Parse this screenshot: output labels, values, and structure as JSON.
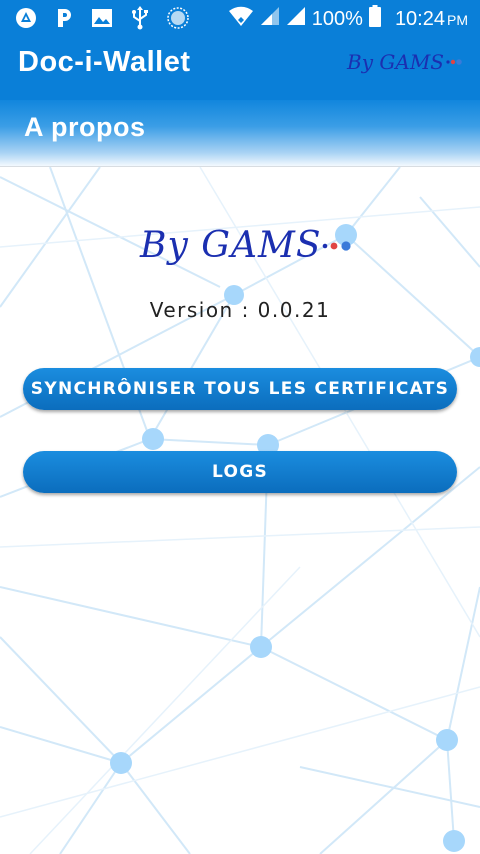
{
  "status_bar": {
    "icons": [
      "android-auto-icon",
      "parking-icon",
      "image-icon",
      "usb-icon",
      "sync-circle-icon",
      "wifi-icon",
      "signal-icon",
      "signal-icon",
      "battery-icon"
    ],
    "battery": "100%",
    "time": "10:24",
    "ampm": "PM"
  },
  "app_bar": {
    "title": "Doc-i-Wallet",
    "brand": "By GAMS"
  },
  "sub_bar": {
    "title": "A propos"
  },
  "about": {
    "brand_logo": "By GAMS",
    "version": "Version : 0.0.21"
  },
  "buttons": {
    "sync": "SYNCHRÔNISER TOUS LES CERTIFICATS",
    "logs": "LOGS"
  },
  "colors": {
    "primary": "#0a7fd8",
    "button": "#0b6dbd",
    "brand": "#1b2fb0",
    "network_line": "#cfe6f7",
    "network_node": "#a7d7fb"
  }
}
